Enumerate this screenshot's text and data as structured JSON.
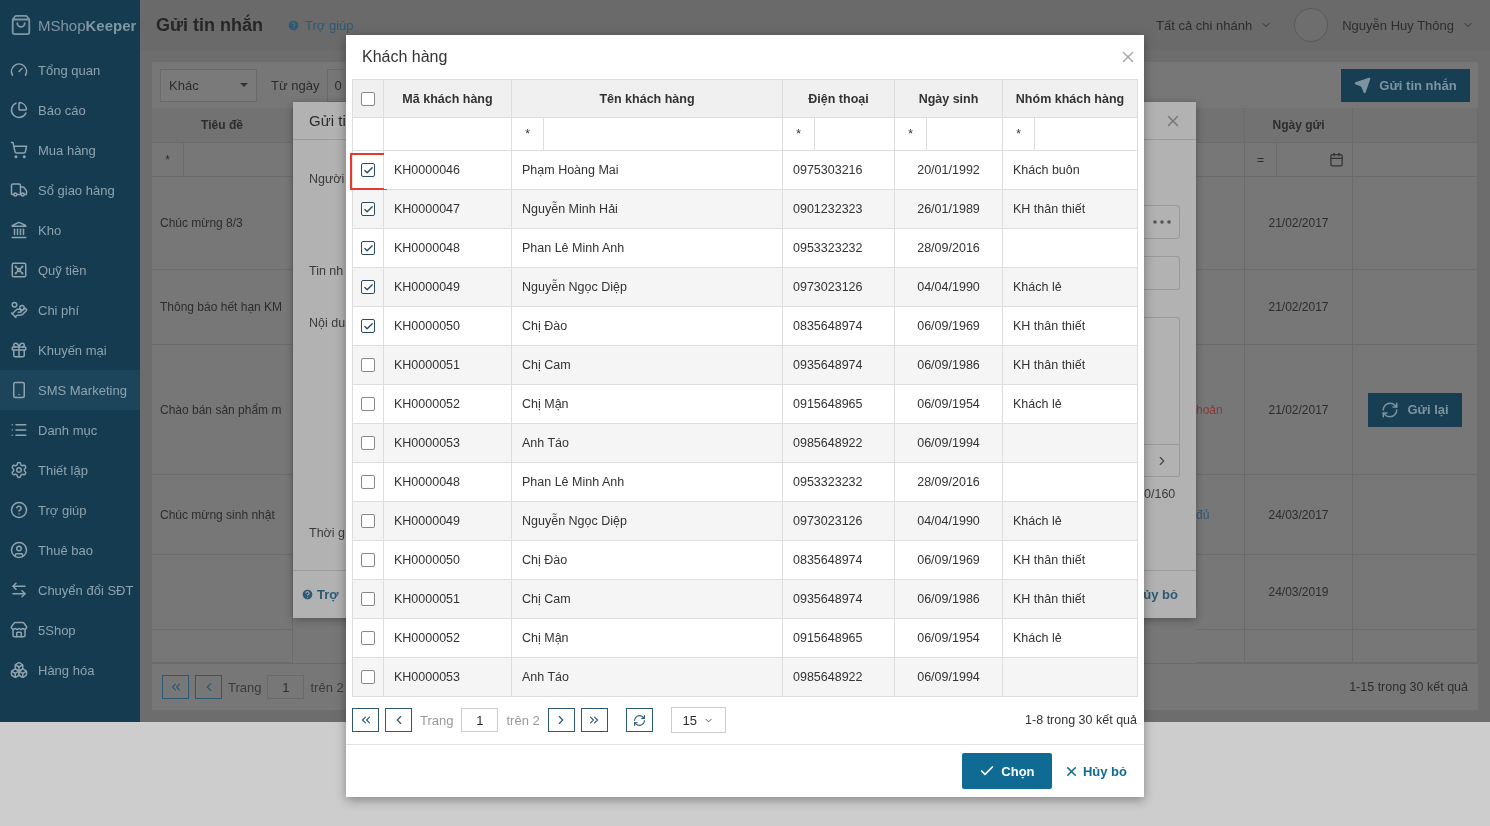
{
  "sidebar": {
    "logo": {
      "light": "MShop",
      "bold": "Keeper"
    },
    "items": [
      {
        "label": "Tổng quan",
        "selected": false
      },
      {
        "label": "Báo cáo",
        "selected": false
      },
      {
        "label": "Mua hàng",
        "selected": false
      },
      {
        "label": "Sổ giao hàng",
        "selected": false
      },
      {
        "label": "Kho",
        "selected": false
      },
      {
        "label": "Quỹ tiền",
        "selected": false
      },
      {
        "label": "Chi phí",
        "selected": false
      },
      {
        "label": "Khuyến mại",
        "selected": false
      },
      {
        "label": "SMS Marketing",
        "selected": true
      },
      {
        "label": "Danh mục",
        "selected": false
      },
      {
        "label": "Thiết lập",
        "selected": false
      },
      {
        "label": "Trợ giúp",
        "selected": false
      },
      {
        "label": "Thuê bao",
        "selected": false
      },
      {
        "label": "Chuyển đổi SĐT",
        "selected": false
      },
      {
        "label": "5Shop",
        "selected": false
      },
      {
        "label": "Hàng hóa",
        "selected": false
      }
    ]
  },
  "header": {
    "title": "Gửi tin nhắn",
    "help": "Trợ giúp",
    "branch": "Tất cả chi nhánh",
    "user": "Nguyễn Huy Thông"
  },
  "toolbar": {
    "type_select": "Khác",
    "from_label": "Từ ngày",
    "from_value": "0",
    "send_button": "Gửi tin nhắn"
  },
  "messages_table": {
    "columns": [
      "Tiêu đề",
      "Ngày gửi"
    ],
    "filters": [
      "*",
      "="
    ],
    "rows": [
      {
        "title": "Chúc mừng 8/3",
        "date": "21/02/2017"
      },
      {
        "title": "Thông báo hết hạn KM",
        "date": "21/02/2017"
      },
      {
        "title": "Chào bán sản phẩm m",
        "status": "hoản",
        "color": "#8a3a33",
        "date": "21/02/2017",
        "action": "Gửi lại"
      },
      {
        "title": "Chúc mừng sinh nhật",
        "status": "đủ",
        "color": "#2c5a74",
        "date": "24/03/2017"
      },
      {
        "date": "24/03/2019"
      }
    ]
  },
  "messages_pager": {
    "page_label": "Trang",
    "page": "1",
    "of": "trên 2",
    "summary": "1-15 trong 30 kết quả"
  },
  "compose_dialog": {
    "title": "Gửi ti",
    "labels": [
      "Người",
      "Tin nh",
      "Nội du",
      "Thời g"
    ],
    "counter": "0/160",
    "help": "Trợ",
    "cancel": "ủy bỏ"
  },
  "customer_dialog": {
    "title": "Khách hàng",
    "all_checked": false,
    "columns": [
      "Mã khách hàng",
      "Tên khách hàng",
      "Điện thoại",
      "Ngày sinh",
      "Nhóm khách hàng"
    ],
    "filter_op": "*",
    "rows": [
      {
        "code": "KH0000046",
        "name": "Phạm Hoàng Mai",
        "phone": "0975303216",
        "birthday": "20/01/1992",
        "group": "Khách buôn",
        "checked": true,
        "highlighted": true
      },
      {
        "code": "KH0000047",
        "name": "Nguyễn Minh Hải",
        "phone": "0901232323",
        "birthday": "26/01/1989",
        "group": "KH thân thiết",
        "checked": true,
        "highlighted": false
      },
      {
        "code": "KH0000048",
        "name": "Phan Lê Minh Anh",
        "phone": "0953323232",
        "birthday": "28/09/2016",
        "checked": true,
        "highlighted": false
      },
      {
        "code": "KH0000049",
        "name": "Nguyễn Ngọc Diệp",
        "phone": "0973023126",
        "birthday": "04/04/1990",
        "group": "Khách lẻ",
        "checked": true,
        "highlighted": false
      },
      {
        "code": "KH0000050",
        "name": "Chị Đào",
        "phone": "0835648974",
        "birthday": "06/09/1969",
        "group": "KH thân thiết",
        "checked": true,
        "highlighted": false
      },
      {
        "code": "KH0000051",
        "name": "Chị Cam",
        "phone": "0935648974",
        "birthday": "06/09/1986",
        "group": "KH thân thiết",
        "checked": false,
        "highlighted": false
      },
      {
        "code": "KH0000052",
        "name": "Chị Mận",
        "phone": "0915648965",
        "birthday": "06/09/1954",
        "group": "Khách lẻ",
        "checked": false,
        "highlighted": false
      },
      {
        "code": "KH0000053",
        "name": "Anh Táo",
        "phone": "0985648922",
        "birthday": "06/09/1994",
        "checked": false,
        "highlighted": false
      },
      {
        "code": "KH0000048",
        "name": "Phan Lê Minh Anh",
        "phone": "0953323232",
        "birthday": "28/09/2016",
        "checked": false,
        "highlighted": false
      },
      {
        "code": "KH0000049",
        "name": "Nguyễn Ngọc Diệp",
        "phone": "0973023126",
        "birthday": "04/04/1990",
        "group": "Khách lẻ",
        "checked": false,
        "highlighted": false
      },
      {
        "code": "KH0000050",
        "name": "Chị Đào",
        "phone": "0835648974",
        "birthday": "06/09/1969",
        "group": "KH thân thiết",
        "checked": false,
        "highlighted": false
      },
      {
        "code": "KH0000051",
        "name": "Chị Cam",
        "phone": "0935648974",
        "birthday": "06/09/1986",
        "group": "KH thân thiết",
        "checked": false,
        "highlighted": false
      },
      {
        "code": "KH0000052",
        "name": "Chị Mận",
        "phone": "0915648965",
        "birthday": "06/09/1954",
        "group": "Khách lẻ",
        "checked": false,
        "highlighted": false
      },
      {
        "code": "KH0000053",
        "name": "Anh Táo",
        "phone": "0985648922",
        "birthday": "06/09/1994",
        "checked": false,
        "highlighted": false
      }
    ],
    "pager": {
      "page_label": "Trang",
      "page": "1",
      "of": "trên 2",
      "page_size": "15",
      "summary": "1-8 trong 30 kết quả"
    },
    "ok_button": "Chọn",
    "cancel_button": "Hủy bỏ"
  }
}
